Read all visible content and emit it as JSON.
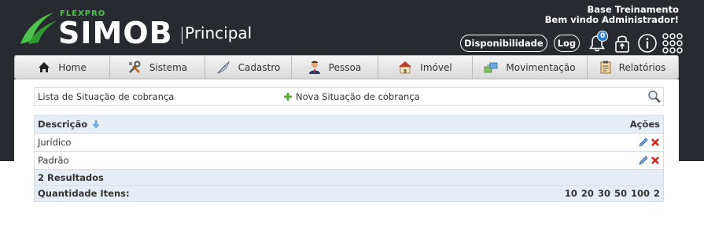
{
  "logo": {
    "brand_small": "FLEXPRO",
    "brand": "SIMOB",
    "section": "Principal"
  },
  "header": {
    "base_name": "Base Treinamento",
    "welcome": "Bem vindo Administrador!",
    "availability_label": "Disponibilidade",
    "log_label": "Log",
    "notification_count": "0",
    "icons": [
      "bell-icon",
      "lock-icon",
      "info-icon",
      "apps-grid-icon"
    ]
  },
  "nav": {
    "items": [
      {
        "label": "Home",
        "icon": "home-icon"
      },
      {
        "label": "Sistema",
        "icon": "tools-icon"
      },
      {
        "label": "Cadastro",
        "icon": "feather-icon"
      },
      {
        "label": "Pessoa",
        "icon": "person-icon"
      },
      {
        "label": "Imóvel",
        "icon": "house-icon"
      },
      {
        "label": "Movimentação",
        "icon": "transfer-icon"
      },
      {
        "label": "Relatórios",
        "icon": "clipboard-icon"
      }
    ]
  },
  "toolbar": {
    "title": "Lista de Situação de cobrança",
    "new_label": "Nova Situação de cobrança",
    "icons": [
      "plus-icon",
      "search-icon"
    ]
  },
  "table": {
    "headers": {
      "description": "Descrição",
      "actions": "Ações"
    },
    "rows": [
      {
        "description": "Jurídico"
      },
      {
        "description": "Padrão"
      }
    ],
    "results_text": "2 Resultados",
    "quantity_label": "Quantidade Itens:",
    "page_sizes": [
      "10",
      "20",
      "30",
      "50",
      "100",
      "2"
    ]
  },
  "colors": {
    "header_bg": "#272b30",
    "brand_green": "#4cc34a",
    "grid_header_bg": "#e6edf5",
    "badge_blue": "#2a7fd4",
    "delete_red": "#d9261c"
  }
}
